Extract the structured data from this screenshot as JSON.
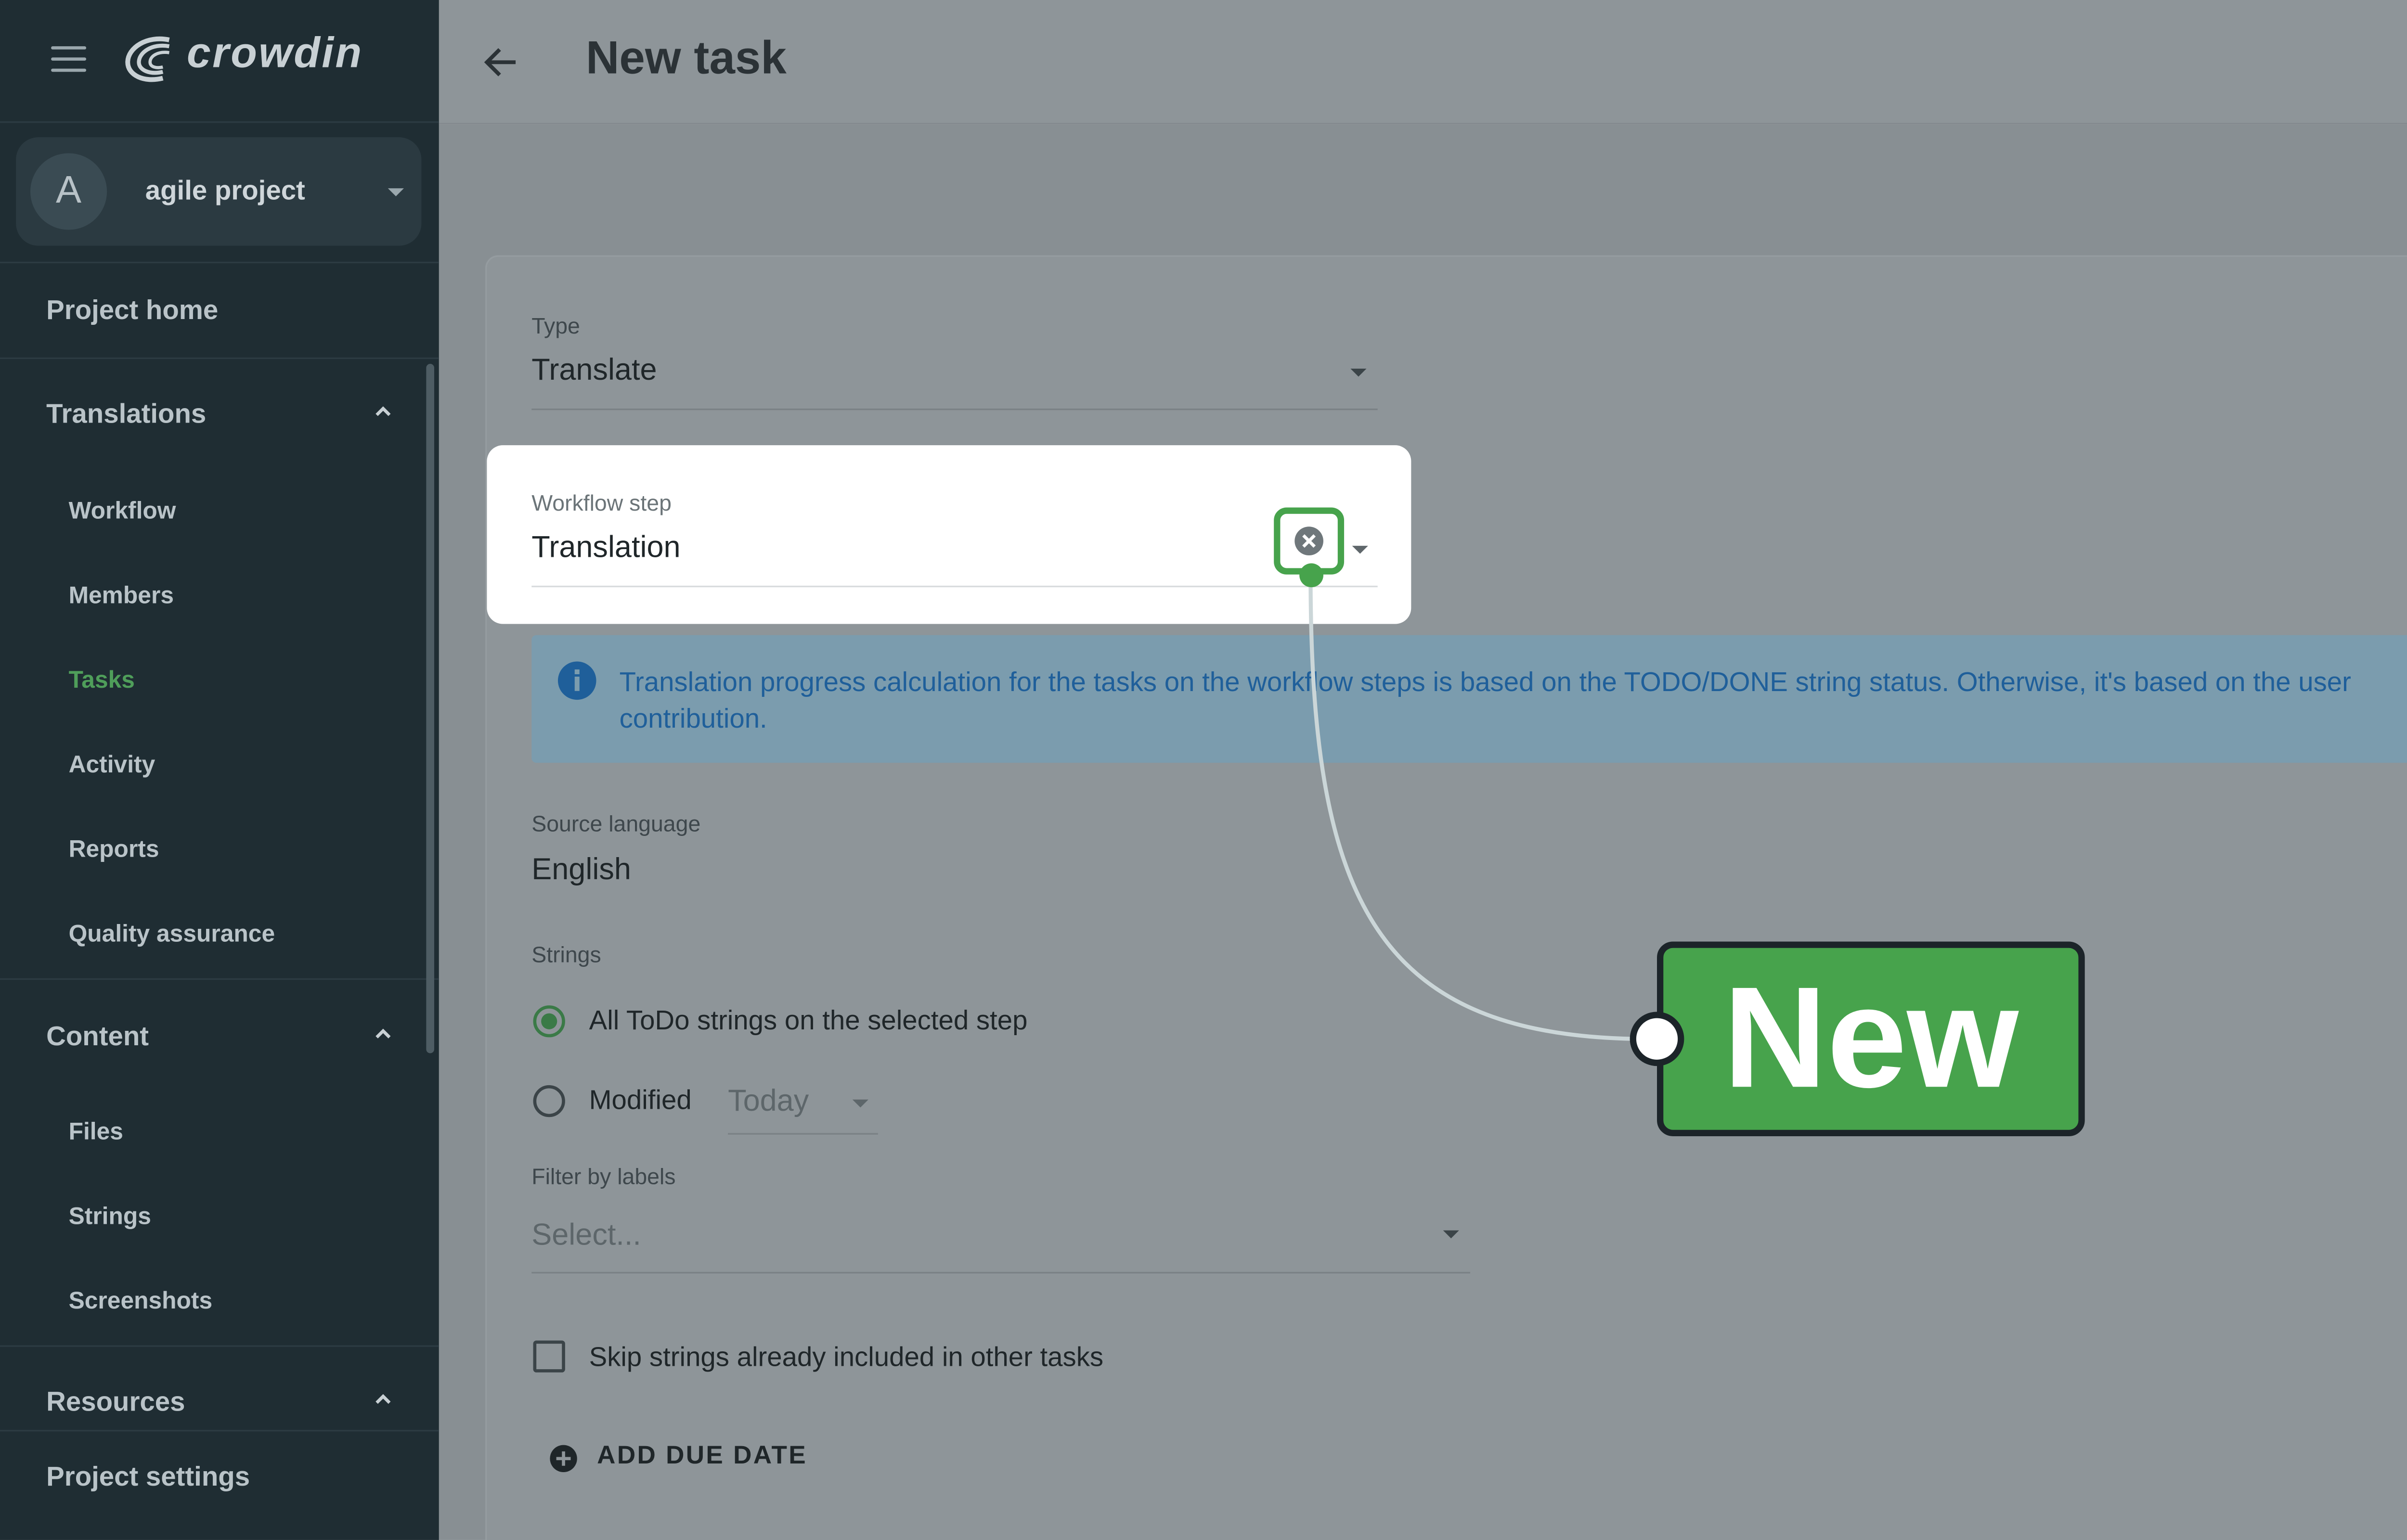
{
  "brand": {
    "logo_text": "crowdin",
    "accent": "#47a34c",
    "sidebar_bg": "#1f2d33"
  },
  "project": {
    "avatar_letter": "A",
    "name": "agile project"
  },
  "sidebar": {
    "project_home": "Project home",
    "translations": {
      "label": "Translations",
      "items": [
        "Workflow",
        "Members",
        "Tasks",
        "Activity",
        "Reports",
        "Quality assurance"
      ],
      "active": "Tasks"
    },
    "content": {
      "label": "Content",
      "items": [
        "Files",
        "Strings",
        "Screenshots"
      ]
    },
    "resources": {
      "label": "Resources"
    },
    "project_settings": "Project settings"
  },
  "header": {
    "title": "New task"
  },
  "form": {
    "type": {
      "label": "Type",
      "value": "Translate"
    },
    "workflow_step": {
      "label": "Workflow step",
      "value": "Translation"
    },
    "info": "Translation progress calculation for the tasks on the workflow steps is based on the TODO/DONE string status. Otherwise, it's based on the user contribution.",
    "source_language": {
      "label": "Source language",
      "value": "English"
    },
    "strings": {
      "label": "Strings",
      "option_all": "All ToDo strings on the selected step",
      "option_modified": "Modified",
      "modified_value": "Today",
      "selected": "all"
    },
    "filter_labels": {
      "label": "Filter by labels",
      "placeholder": "Select..."
    },
    "skip_label": "Skip strings already included in other tasks",
    "add_due_date": "ADD DUE DATE"
  },
  "callout": {
    "text": "New"
  }
}
